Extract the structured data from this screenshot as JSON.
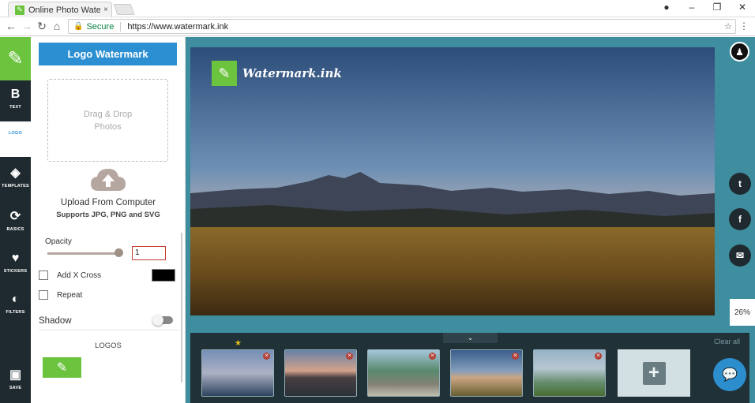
{
  "browser": {
    "tab_title": "Online Photo Watermark",
    "tab_close": "×",
    "secure_label": "Secure",
    "url": "https://www.watermark.ink"
  },
  "sidebar": {
    "items": [
      {
        "label": "TEXT",
        "icon": "B"
      },
      {
        "label": "LOGO",
        "icon": ""
      },
      {
        "label": "TEMPLATES",
        "icon": "◈"
      },
      {
        "label": "BASICS",
        "icon": "⟳"
      },
      {
        "label": "STICKERS",
        "icon": "♥"
      },
      {
        "label": "FILTERS",
        "icon": "◐"
      },
      {
        "label": "SAVE",
        "icon": "▣"
      }
    ]
  },
  "panel": {
    "title": "Logo Watermark",
    "dropzone_line1": "Drag & Drop",
    "dropzone_line2": "Photos",
    "upload_text": "Upload From Computer",
    "upload_sub": "Supports JPG, PNG and SVG",
    "opacity_label": "Opacity",
    "opacity_value": "1",
    "opacity_level": 1.0,
    "add_x_cross_label": "Add X Cross",
    "repeat_label": "Repeat",
    "shadow_label": "Shadow",
    "logos_label": "LOGOS",
    "cross_color": "#000000"
  },
  "workspace": {
    "watermark_text": "Watermark.ink",
    "zoom": "26%",
    "share_labels": [
      "t",
      "f",
      "✉"
    ],
    "clear_all": "Clear all",
    "tray_handle": "⌄"
  },
  "colors": {
    "brand_green": "#6cc33e",
    "accent_blue": "#2b8fd1",
    "dark_bar": "#1f2a30",
    "workspace_bg": "#3e8ea0"
  }
}
